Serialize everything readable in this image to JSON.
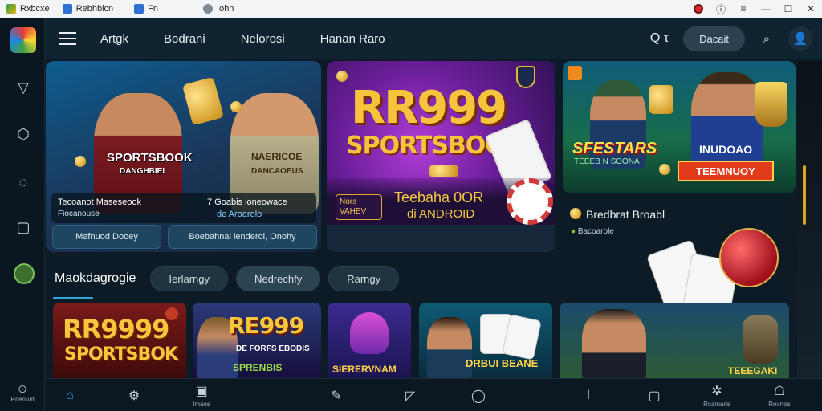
{
  "titlebar": {
    "tabs": [
      "Rxbcxe",
      "Rebhbicn",
      "Fn",
      "Iohn"
    ]
  },
  "rail": {
    "bottom_label": "Rceouid"
  },
  "topnav": {
    "links": [
      "Artgk",
      "Bodrani",
      "Nelorosi",
      "Hanan Raro"
    ],
    "search_label": "Q",
    "search_mark": "τ",
    "pill_label": "Dacait"
  },
  "banner1": {
    "jersey_left": "SPORTSBOOK",
    "jersey_left_sub": "DANGHBIEI",
    "jersey_right": "NAERICOE",
    "jersey_right_sub": "DANCAOEUS",
    "caption_left_title": "Tecoanot Maseseook",
    "caption_left_sub": "Fiocanouse",
    "caption_right_title": "7 Goabis ioneowace",
    "caption_right_sub": "de Aroarolo",
    "button_left": "Mafnuod Dooey",
    "button_right": "Boebahnal lenderol, Onohy"
  },
  "banner2": {
    "title": "RR999",
    "subtitle": "SPORTSBOOK",
    "badge": "Nors VAHEV",
    "promo_line1": "Teebaha 0OR",
    "promo_line2": "di ANDROID"
  },
  "banner3": {
    "title": "SFESTARS",
    "subtitle": "TEEEB N SOONA",
    "jersey": "INUDOAO",
    "sign": "TEEMNUOY"
  },
  "side": {
    "title": "Bredbrat Broabl",
    "subtitle": "Bacoarole"
  },
  "categories": {
    "label": "Maokdagrogie",
    "chips": [
      "Ierlarngy",
      "Nedrechfy",
      "Rarngy"
    ]
  },
  "tiles": [
    {
      "title": "RR9999",
      "sub": "SPORTSBOK"
    },
    {
      "title": "RE999",
      "sub": "DE FORFS EBODIS",
      "sub2": "SPRENBIS"
    },
    {
      "title": "",
      "sub": "SIERERVNAM"
    },
    {
      "title": "",
      "sub": "DRBUI BEANE"
    },
    {
      "title": "",
      "sub": "TEEEGAKI"
    }
  ],
  "bottombar": {
    "items": [
      {
        "icon": "home-icon",
        "label": ""
      },
      {
        "icon": "gear-icon",
        "label": ""
      },
      {
        "icon": "casino-icon",
        "label": "Imaos"
      },
      {
        "icon": "edit-icon",
        "label": ""
      },
      {
        "icon": "chat-icon",
        "label": ""
      },
      {
        "icon": "user-icon",
        "label": ""
      },
      {
        "icon": "pin-icon",
        "label": ""
      },
      {
        "icon": "frame-icon",
        "label": ""
      },
      {
        "icon": "settings-icon",
        "label": "Rcamaris"
      },
      {
        "icon": "profile-icon",
        "label": "Roxrtos"
      }
    ]
  },
  "colors": {
    "accent": "#2fa7d8",
    "gold": "#f6c33c",
    "background": "#0d1b26"
  }
}
